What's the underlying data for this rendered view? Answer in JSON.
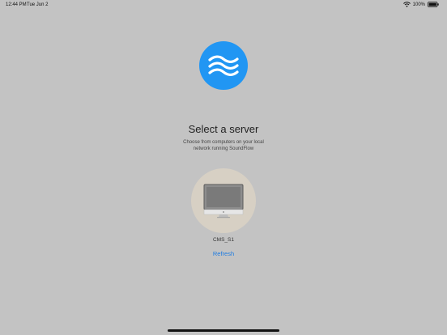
{
  "status_bar": {
    "time": "12:44 PM",
    "date": "Tue Jun 2",
    "battery": "100%"
  },
  "icons": {
    "logo": "soundflow-logo-icon",
    "wifi": "wifi-icon",
    "battery": "battery-icon",
    "computer": "imac-computer-icon"
  },
  "colors": {
    "background": "#c3c3c3",
    "logo": "#2196f3",
    "link": "#1e7be0",
    "server_tile": "#d7d0c4"
  },
  "main": {
    "title": "Select a server",
    "subtitle": "Choose from computers on your local network running SoundFlow"
  },
  "servers": [
    {
      "name": "CMS_S1"
    }
  ],
  "actions": {
    "refresh_label": "Refresh"
  }
}
